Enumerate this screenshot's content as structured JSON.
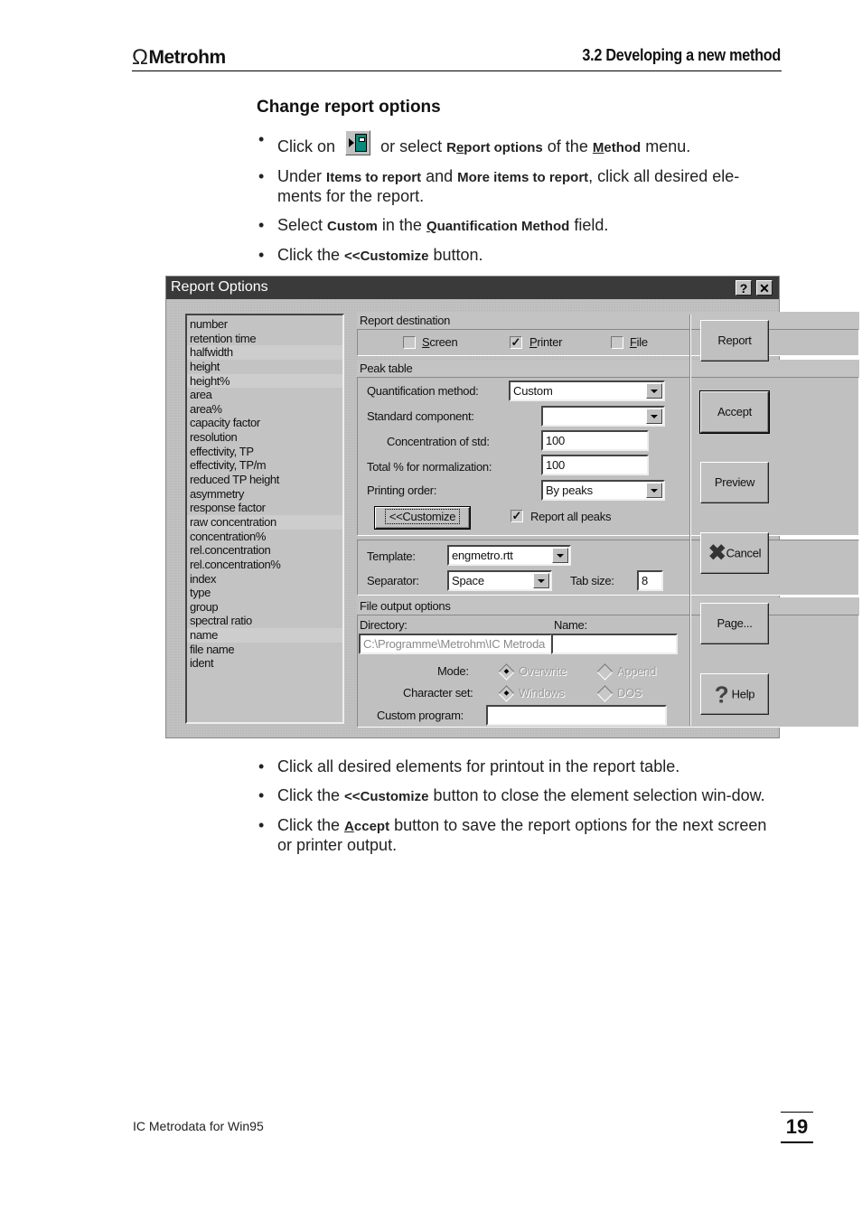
{
  "header": {
    "logo_symbol": "Ω",
    "logo_text": "Metrohm",
    "section_title": "3.2  Developing a new method"
  },
  "instructions": {
    "heading": "Change report options",
    "step1": {
      "pre": "Click on",
      "icon": "report-options-toolbar-icon",
      "mid": "or select",
      "menu_item_r": "R",
      "menu_item_e": "e",
      "menu_item_rest": "port options",
      "of_the": "of the",
      "menu_m": "M",
      "menu_rest": "ethod",
      "post": "menu."
    },
    "step2": {
      "pre": "Under",
      "bold1": "Items to report",
      "and": "and",
      "bold2": "More items to report",
      "post": ", click all desired ele-ments for the report."
    },
    "step3": {
      "pre": "Select",
      "bold1": "Custom",
      "mid": "in the",
      "bold2_u": "Q",
      "bold2_rest": "uantification Method",
      "post": "field."
    },
    "step4": {
      "pre": "Click the",
      "bold": "<<Customize",
      "post": "button."
    }
  },
  "dialog": {
    "title": "Report Options",
    "help_btn": "?",
    "close_btn": "✕",
    "items": [
      "number",
      "retention time",
      "halfwidth",
      "height",
      "height%",
      "area",
      "area%",
      "capacity factor",
      "resolution",
      "effectivity, TP",
      "effectivity, TP/m",
      "reduced TP height",
      "asymmetry",
      "response factor",
      "raw concentration",
      "concentration%",
      "rel.concentration",
      "rel.concentration%",
      "index",
      "type",
      "group",
      "spectral ratio",
      "name",
      "file name",
      "ident"
    ],
    "report_destination": {
      "label": "Report destination",
      "screen": {
        "label": "Screen",
        "checked": false
      },
      "printer": {
        "label": "Printer",
        "checked": true
      },
      "file": {
        "label": "File",
        "checked": false
      }
    },
    "peak_table": {
      "label": "Peak table",
      "quant_label": "Quantification method:",
      "quant_value": "Custom",
      "std_label": "Standard component:",
      "std_value": "",
      "conc_label": "Concentration of std:",
      "conc_value": "100",
      "total_label": "Total % for normalization:",
      "total_value": "100",
      "order_label": "Printing order:",
      "order_value": "By peaks",
      "customize_btn": "<<Customize",
      "report_all": {
        "label": "Report all peaks",
        "checked": true
      }
    },
    "template": {
      "template_label": "Template:",
      "template_value": "engmetro.rtt",
      "separator_label": "Separator:",
      "separator_value": "Space",
      "tabsize_label": "Tab size:",
      "tabsize_value": "8"
    },
    "file_output": {
      "label": "File output options",
      "directory_label": "Directory:",
      "directory_value": "C:\\Programme\\Metrohm\\IC Metroda",
      "name_label": "Name:",
      "name_value": "",
      "mode_label": "Mode:",
      "mode_overwrite": "Overwrite",
      "mode_append": "Append",
      "charset_label": "Character set:",
      "charset_windows": "Windows",
      "charset_dos": "DOS",
      "custom_program_label": "Custom program:",
      "custom_program_value": ""
    },
    "buttons": {
      "report": "Report",
      "accept": "Accept",
      "preview": "Preview",
      "cancel": "Cancel",
      "page": "Page...",
      "help": "Help"
    }
  },
  "followup": {
    "step5": "Click all desired elements for printout in the report table.",
    "step6": {
      "pre": "Click the",
      "bold": "<<Customize",
      "post": "button to close the element selection win-dow."
    },
    "step7": {
      "pre": "Click the",
      "bold_u": "A",
      "bold_rest": "ccept",
      "post": "button to save the report options for the next screen or printer output."
    }
  },
  "footer": {
    "product": "IC Metrodata for Win95",
    "page_number": "19"
  }
}
